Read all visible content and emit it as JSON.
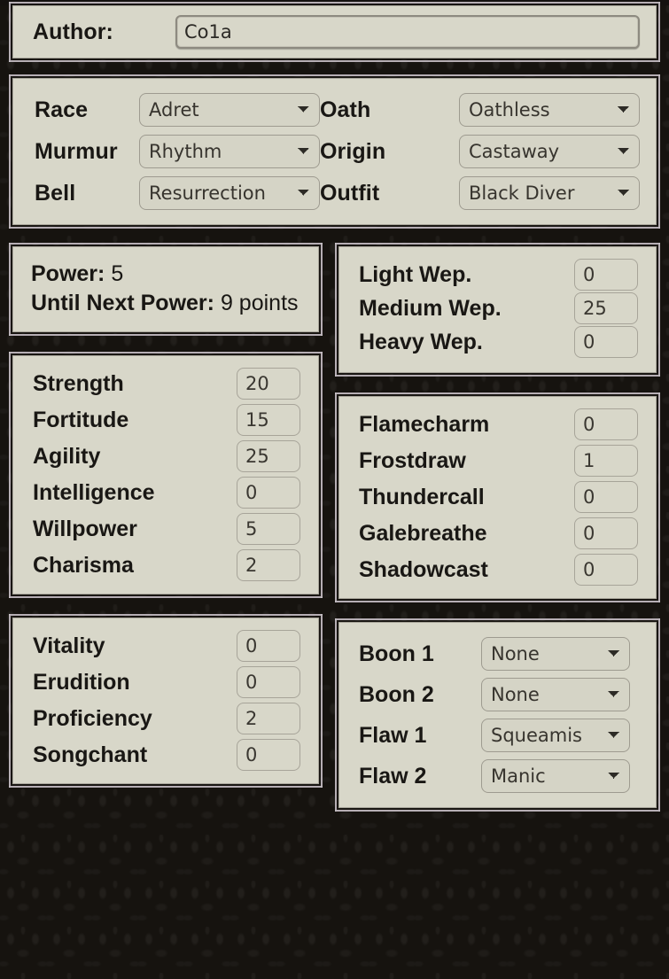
{
  "author": {
    "label": "Author:",
    "value": "Co1a",
    "placeholder": ""
  },
  "identity": {
    "rows": [
      {
        "label": "Race",
        "value": "Adret",
        "options": [
          "Adret"
        ]
      },
      {
        "label": "Murmur",
        "value": "Rhythm",
        "options": [
          "Rhythm"
        ]
      },
      {
        "label": "Bell",
        "value": "Resurrection",
        "options": [
          "Resurrection"
        ]
      }
    ],
    "rows_right": [
      {
        "label": "Oath",
        "value": "Oathless",
        "options": [
          "Oathless"
        ]
      },
      {
        "label": "Origin",
        "value": "Castaway",
        "options": [
          "Castaway"
        ]
      },
      {
        "label": "Outfit",
        "value": "Black Diver",
        "options": [
          "Black Diver"
        ]
      }
    ]
  },
  "power": {
    "power_label": "Power:",
    "power_value": "5",
    "next_label": "Until Next Power:",
    "next_value": "9",
    "next_unit": "points"
  },
  "weapons": {
    "rows": [
      {
        "label": "Light Wep.",
        "value": "0"
      },
      {
        "label": "Medium Wep.",
        "value": "25"
      },
      {
        "label": "Heavy Wep.",
        "value": "0"
      }
    ]
  },
  "attributes": {
    "rows": [
      {
        "label": "Strength",
        "value": "20"
      },
      {
        "label": "Fortitude",
        "value": "15"
      },
      {
        "label": "Agility",
        "value": "25"
      },
      {
        "label": "Intelligence",
        "value": "0"
      },
      {
        "label": "Willpower",
        "value": "5"
      },
      {
        "label": "Charisma",
        "value": "2"
      }
    ]
  },
  "magic": {
    "rows": [
      {
        "label": "Flamecharm",
        "value": "0"
      },
      {
        "label": "Frostdraw",
        "value": "1"
      },
      {
        "label": "Thundercall",
        "value": "0"
      },
      {
        "label": "Galebreathe",
        "value": "0"
      },
      {
        "label": "Shadowcast",
        "value": "0"
      }
    ]
  },
  "skills": {
    "rows": [
      {
        "label": "Vitality",
        "value": "0"
      },
      {
        "label": "Erudition",
        "value": "0"
      },
      {
        "label": "Proficiency",
        "value": "2"
      },
      {
        "label": "Songchant",
        "value": "0"
      }
    ]
  },
  "boons": {
    "rows": [
      {
        "label": "Boon 1",
        "value": "None",
        "options": [
          "None"
        ]
      },
      {
        "label": "Boon 2",
        "value": "None",
        "options": [
          "None"
        ]
      },
      {
        "label": "Flaw 1",
        "value": "Squeamis",
        "options": [
          "Squeamis"
        ]
      },
      {
        "label": "Flaw 2",
        "value": "Manic",
        "options": [
          "Manic"
        ]
      }
    ]
  },
  "colors": {
    "panel_bg": "#d8d7c9",
    "page_bg": "#16130f",
    "frame": "#b6aeb4",
    "text": "#191714"
  }
}
